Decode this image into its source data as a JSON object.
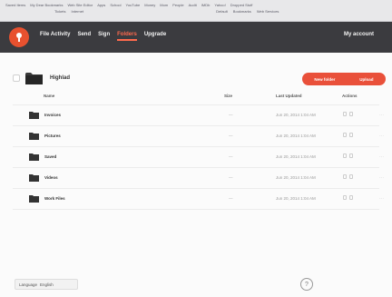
{
  "browser": {
    "bookmarks": [
      "Saved Items",
      "My Dear Bookmarks",
      "Web Site Editor",
      "Apps",
      "School",
      "YouTube",
      "Money",
      "Mom",
      "People",
      "Audit",
      "IMDb",
      "Yahoo!",
      "Dropped Stuff"
    ],
    "subline_left": [
      "Tickets",
      "Internet"
    ],
    "subline_right": [
      "Default",
      "Bookmarks",
      "Web Services"
    ]
  },
  "nav": {
    "items": [
      "File Activity",
      "Send",
      "Sign",
      "Folders",
      "Upgrade"
    ],
    "active_index": 3,
    "account": "My account"
  },
  "folder": {
    "title": "Highlad",
    "buttons": {
      "new_folder": "New folder",
      "upload": "Upload"
    }
  },
  "table": {
    "headers": {
      "name": "Name",
      "size": "Size",
      "updated": "Last Updated",
      "actions": "Actions"
    },
    "rows": [
      {
        "name": "Invoices",
        "size": "—",
        "date": "Jun 20, 2014 1:04 AM"
      },
      {
        "name": "Pictures",
        "size": "—",
        "date": "Jun 20, 2014 1:04 AM"
      },
      {
        "name": "Saved",
        "size": "—",
        "date": "Jun 20, 2014 1:04 AM"
      },
      {
        "name": "Videos",
        "size": "—",
        "date": "Jun 20, 2014 1:04 AM"
      },
      {
        "name": "Work Files",
        "size": "—",
        "date": "Jun 20, 2014 1:04 AM"
      }
    ],
    "more_glyph": "···"
  },
  "footer": {
    "language_label": "Language",
    "language_value": "English",
    "help_glyph": "?"
  },
  "colors": {
    "accent": "#e9503a",
    "nav_bg": "#3b3b3f"
  }
}
